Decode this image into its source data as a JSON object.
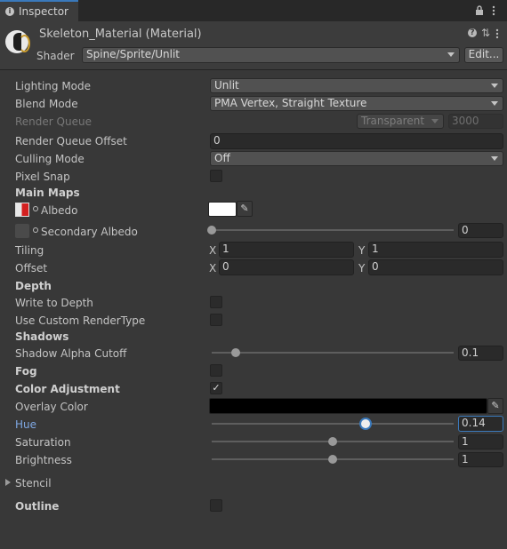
{
  "window": {
    "tab_title": "Inspector",
    "tab_icon": "info-icon",
    "toolbar_icons": [
      "lock-icon",
      "kebab-menu-icon"
    ]
  },
  "header": {
    "material_name": "Skeleton_Material (Material)",
    "shader_label": "Shader",
    "shader_value": "Spine/Sprite/Unlit",
    "edit_button": "Edit...",
    "icons": [
      "help-icon",
      "preset-icon",
      "kebab-menu-icon"
    ]
  },
  "properties": {
    "lighting_mode": {
      "label": "Lighting Mode",
      "value": "Unlit"
    },
    "blend_mode": {
      "label": "Blend Mode",
      "value": "PMA Vertex, Straight Texture"
    },
    "render_queue": {
      "label": "Render Queue",
      "value": "Transparent",
      "number": "3000"
    },
    "render_queue_offset": {
      "label": "Render Queue Offset",
      "value": "0"
    },
    "culling_mode": {
      "label": "Culling Mode",
      "value": "Off"
    },
    "pixel_snap": {
      "label": "Pixel Snap",
      "checked": false
    },
    "main_maps": {
      "label": "Main Maps"
    },
    "albedo": {
      "label": "Albedo",
      "color": "#ffffff"
    },
    "secondary_albedo": {
      "label": "Secondary Albedo",
      "value": "0",
      "slider": 0
    },
    "tiling": {
      "label": "Tiling",
      "x_label": "X",
      "x": "1",
      "y_label": "Y",
      "y": "1"
    },
    "offset": {
      "label": "Offset",
      "x_label": "X",
      "x": "0",
      "y_label": "Y",
      "y": "0"
    },
    "depth": {
      "label": "Depth"
    },
    "write_to_depth": {
      "label": "Write to Depth",
      "checked": false
    },
    "use_custom_rendertype": {
      "label": "Use Custom RenderType",
      "checked": false
    },
    "shadows": {
      "label": "Shadows"
    },
    "shadow_alpha_cutoff": {
      "label": "Shadow Alpha Cutoff",
      "value": "0.1",
      "slider": 0.1
    },
    "fog": {
      "label": "Fog",
      "checked": false
    },
    "color_adjustment": {
      "label": "Color Adjustment",
      "checked": true,
      "check_mark": "✓"
    },
    "overlay_color": {
      "label": "Overlay Color",
      "color": "#000000"
    },
    "hue": {
      "label": "Hue",
      "value": "0.14",
      "slider": 0.635
    },
    "saturation": {
      "label": "Saturation",
      "value": "1",
      "slider": 0.5
    },
    "brightness": {
      "label": "Brightness",
      "value": "1",
      "slider": 0.5
    },
    "stencil": {
      "label": "Stencil",
      "expanded": false
    },
    "outline": {
      "label": "Outline",
      "checked": false
    }
  },
  "colors": {
    "accent": "#3a79bb",
    "panel_bg": "#383838"
  }
}
